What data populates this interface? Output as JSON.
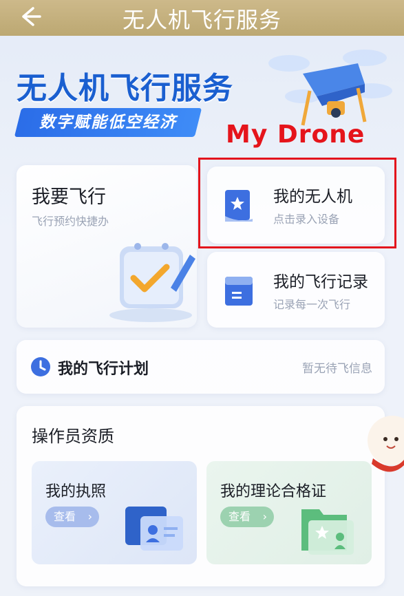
{
  "header": {
    "title": "无人机飞行服务",
    "back_icon": "arrow-left-icon"
  },
  "hero": {
    "title": "无人机飞行服务",
    "subtitle": "数字赋能低空经济"
  },
  "annotation": {
    "label": "My Drone",
    "color": "#e3141c"
  },
  "cards": {
    "fly": {
      "title": "我要飞行",
      "subtitle": "飞行预约快捷办"
    },
    "my_drone": {
      "title": "我的无人机",
      "subtitle": "点击录入设备",
      "icon": "star-bookmark-icon"
    },
    "records": {
      "title": "我的飞行记录",
      "subtitle": "记录每一次飞行",
      "icon": "folder-icon"
    },
    "plan": {
      "title": "我的飞行计划",
      "status": "暂无待飞信息",
      "icon": "clock-icon"
    }
  },
  "qualifications": {
    "title": "操作员资质",
    "license": {
      "title": "我的执照",
      "button": "查看"
    },
    "certificate": {
      "title": "我的理论合格证",
      "button": "查看"
    }
  },
  "colors": {
    "brand_blue": "#1a5fd0",
    "header_gold": "#c4b07c"
  }
}
